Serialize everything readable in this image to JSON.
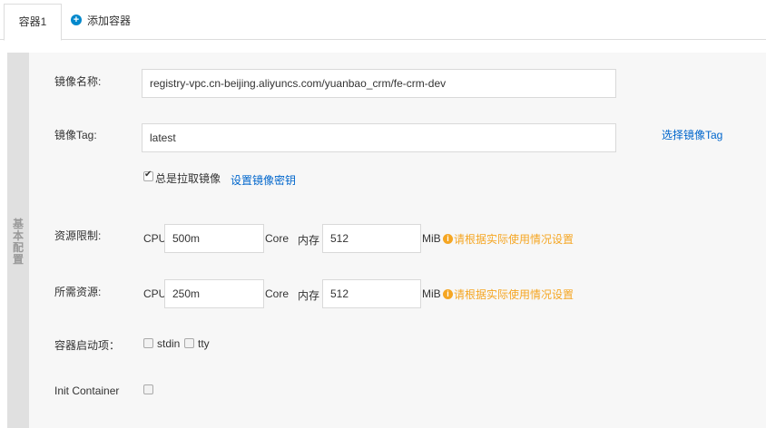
{
  "tabs": {
    "active_label": "容器1",
    "add_label": "添加容器"
  },
  "section": {
    "side_label": "基本配置"
  },
  "image_name": {
    "label": "镜像名称:",
    "value": "registry-vpc.cn-beijing.aliyuncs.com/yuanbao_crm/fe-crm-dev"
  },
  "image_tag": {
    "label": "镜像Tag:",
    "value": "latest",
    "select_link": "选择镜像Tag",
    "always_pull_label": "总是拉取镜像",
    "always_pull_checked": true,
    "secret_link": "设置镜像密钥"
  },
  "resource_limit": {
    "label": "资源限制:",
    "cpu_label": "CPU",
    "cpu_value": "500m",
    "core_label": "Core",
    "mem_label": "内存",
    "mem_value": "512",
    "mib_label": "MiB",
    "hint": "请根据实际使用情况设置"
  },
  "resource_request": {
    "label": "所需资源:",
    "cpu_label": "CPU",
    "cpu_value": "250m",
    "core_label": "Core",
    "mem_label": "内存",
    "mem_value": "512",
    "mib_label": "MiB",
    "hint": "请根据实际使用情况设置"
  },
  "startup": {
    "label": "容器启动项：",
    "stdin_label": "stdin",
    "stdin_checked": false,
    "tty_label": "tty",
    "tty_checked": false
  },
  "init_container": {
    "label": "Init Container",
    "checked": false
  },
  "colors": {
    "link": "#0066cc",
    "warning": "#f5a623",
    "add_icon": "#0088cc",
    "panel_bg": "#f7f7f7"
  },
  "icons": {
    "add": "plus-circle-icon",
    "warning": "info-circle-icon"
  }
}
